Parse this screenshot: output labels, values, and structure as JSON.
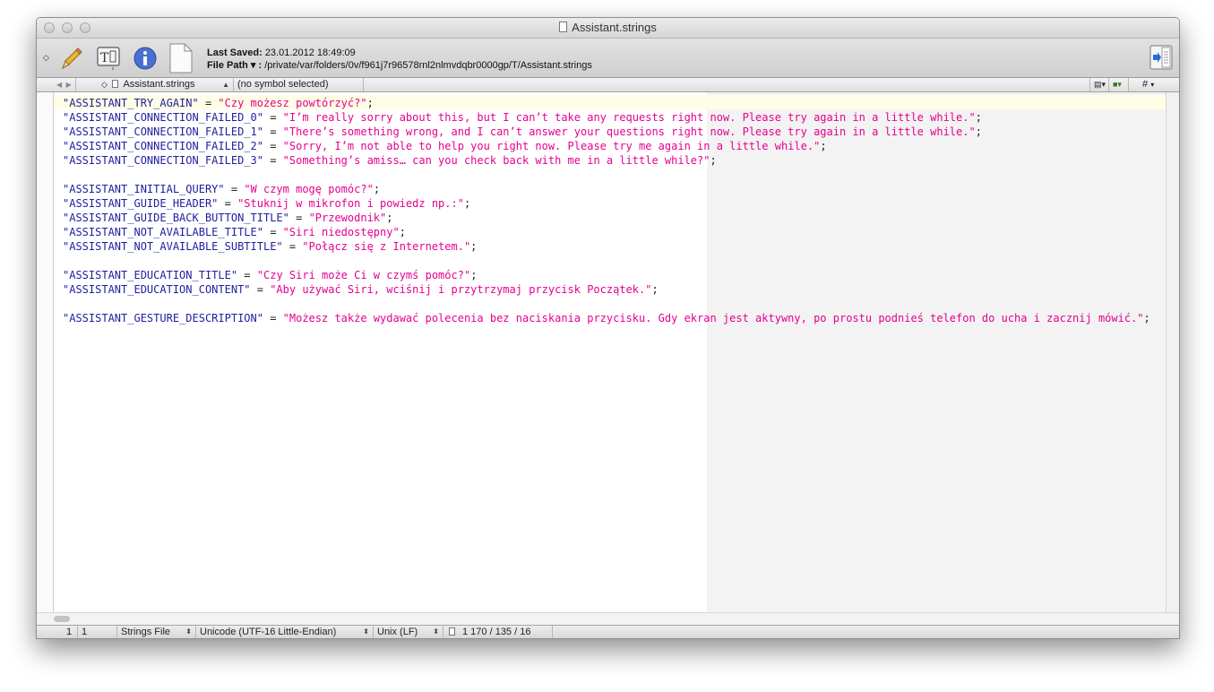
{
  "window": {
    "title": "Assistant.strings"
  },
  "toolbar": {
    "last_saved_label": "Last Saved:",
    "last_saved_value": "23.01.2012 18:49:09",
    "file_path_label": "File Path ▾ :",
    "file_path_value": "/private/var/folders/0v/f961j7r96578rnl2nlmvdqbr0000gp/T/Assistant.strings",
    "icons": [
      "pencil-icon",
      "text-inspector-icon",
      "info-icon",
      "document-icon",
      "sidebar-toggle-icon"
    ]
  },
  "navbar": {
    "file_name": "Assistant.strings",
    "symbol": "(no symbol selected)",
    "hash": "#"
  },
  "editor": {
    "lines": [
      {
        "key": "\"ASSISTANT_TRY_AGAIN\"",
        "value": "\"Czy możesz powtórzyć?\""
      },
      {
        "key": "\"ASSISTANT_CONNECTION_FAILED_0\"",
        "value": "\"I’m really sorry about this, but I can’t take any requests right now. Please try again in a little while.\""
      },
      {
        "key": "\"ASSISTANT_CONNECTION_FAILED_1\"",
        "value": "\"There’s something wrong, and I can’t answer your questions right now. Please try again in a little while.\""
      },
      {
        "key": "\"ASSISTANT_CONNECTION_FAILED_2\"",
        "value": "\"Sorry, I’m not able to help you right now. Please try me again in a little while.\""
      },
      {
        "key": "\"ASSISTANT_CONNECTION_FAILED_3\"",
        "value": "\"Something’s amiss… can you check back with me in a little while?\""
      },
      {
        "key": "",
        "value": ""
      },
      {
        "key": "\"ASSISTANT_INITIAL_QUERY\"",
        "value": "\"W czym mogę pomóc?\""
      },
      {
        "key": "\"ASSISTANT_GUIDE_HEADER\"",
        "value": "\"Stuknij w mikrofon i powiedz np.:\""
      },
      {
        "key": "\"ASSISTANT_GUIDE_BACK_BUTTON_TITLE\"",
        "value": "\"Przewodnik\""
      },
      {
        "key": "\"ASSISTANT_NOT_AVAILABLE_TITLE\"",
        "value": "\"Siri niedostępny\""
      },
      {
        "key": "\"ASSISTANT_NOT_AVAILABLE_SUBTITLE\"",
        "value": "\"Połącz się z Internetem.\""
      },
      {
        "key": "",
        "value": ""
      },
      {
        "key": "\"ASSISTANT_EDUCATION_TITLE\"",
        "value": "\"Czy Siri może Ci w czymś pomóc?\""
      },
      {
        "key": "\"ASSISTANT_EDUCATION_CONTENT\"",
        "value": "\"Aby używać Siri, wciśnij i przytrzymaj przycisk Początek.\""
      },
      {
        "key": "",
        "value": ""
      },
      {
        "key": "\"ASSISTANT_GESTURE_DESCRIPTION\"",
        "value": "\"Możesz także wydawać polecenia bez naciskania przycisku. Gdy ekran jest aktywny, po prostu podnieś telefon do ucha i zacznij mówić.\""
      }
    ],
    "assign": " = ",
    "terminator": ";"
  },
  "statusbar": {
    "line": "1",
    "column": "1",
    "file_type": "Strings File",
    "encoding": "Unicode (UTF-16 Little-Endian)",
    "line_endings": "Unix (LF)",
    "counts": "1 170 / 135 / 16"
  },
  "colors": {
    "key": "#1f1f9e",
    "string": "#e6008f"
  }
}
